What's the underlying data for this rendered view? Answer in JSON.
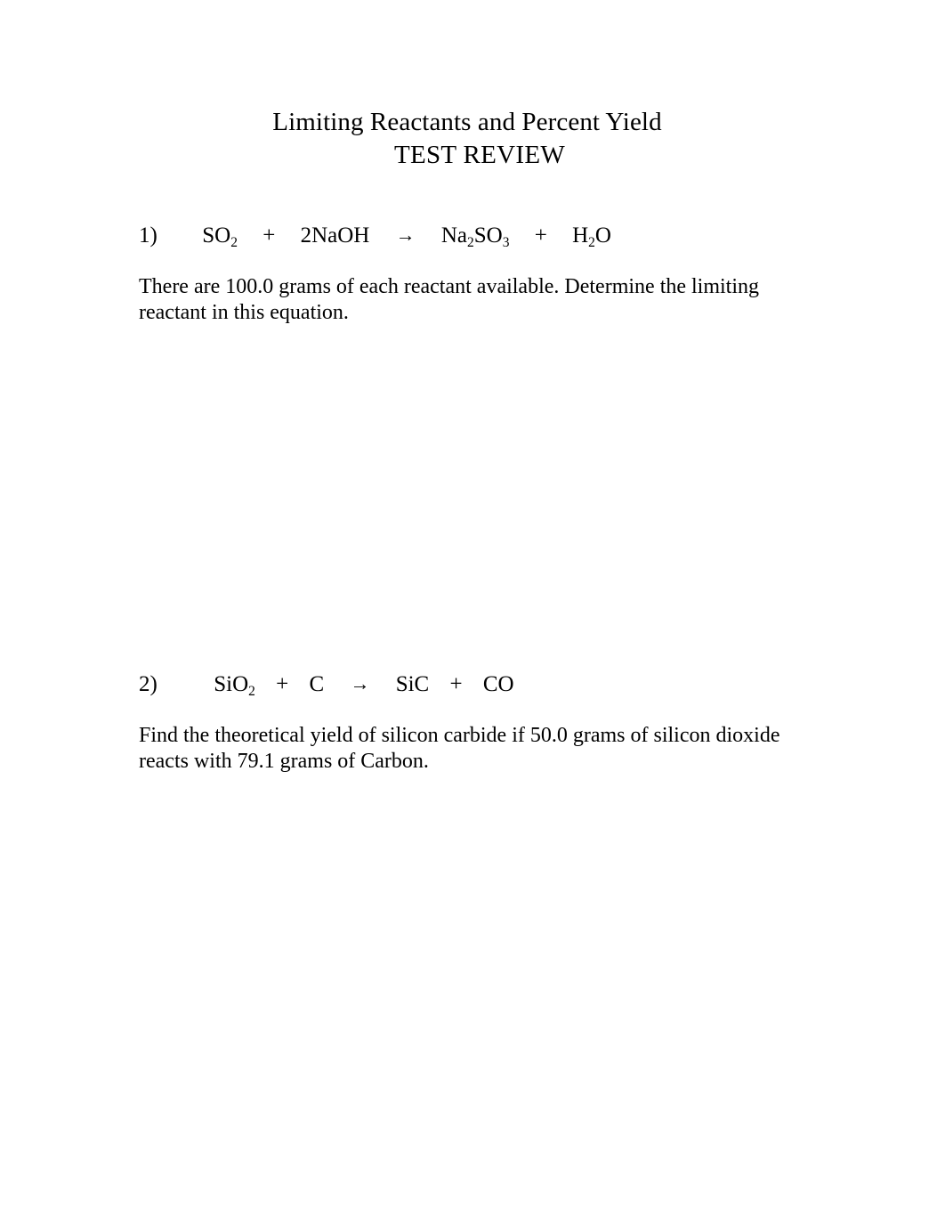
{
  "document": {
    "title_line_1": "Limiting Reactants and Percent Yield",
    "title_line_2": "TEST REVIEW",
    "background_color": "#ffffff",
    "text_color": "#000000"
  },
  "problems": [
    {
      "number": "1)",
      "equation": {
        "plain": "SO2 + 2NaOH → Na2SO3 + H2O",
        "reactant_1": {
          "base_1": "SO",
          "sub_1": "2"
        },
        "operator_1": "+",
        "reactant_2": {
          "base_1": "2NaOH"
        },
        "arrow": "→",
        "product_1": {
          "base_1": "Na",
          "sub_1": "2",
          "base_2": "SO",
          "sub_2": "3"
        },
        "operator_2": "+",
        "product_2": {
          "base_1": "H",
          "sub_1": "2",
          "base_2": "O"
        }
      },
      "prompt": "There are 100.0 grams of each reactant available.  Determine the limiting reactant in this equation.",
      "given_mass_each_reactant_g": "100.0",
      "task": "Determine the limiting reactant"
    },
    {
      "number": "2)",
      "equation": {
        "plain": "SiO2 + C → SiC + CO",
        "reactant_1": {
          "base_1": "SiO",
          "sub_1": "2"
        },
        "operator_1": "+",
        "reactant_2": {
          "base_1": "C"
        },
        "arrow": "→",
        "product_1": {
          "base_1": "SiC"
        },
        "operator_2": "+",
        "product_2": {
          "base_1": "CO"
        }
      },
      "prompt": "Find the theoretical yield of silicon carbide if 50.0 grams of silicon dioxide reacts with 79.1 grams of Carbon.",
      "given_mass_silicon_dioxide_g": "50.0",
      "given_mass_carbon_g": "79.1",
      "task": "Find the theoretical yield of silicon carbide"
    }
  ]
}
